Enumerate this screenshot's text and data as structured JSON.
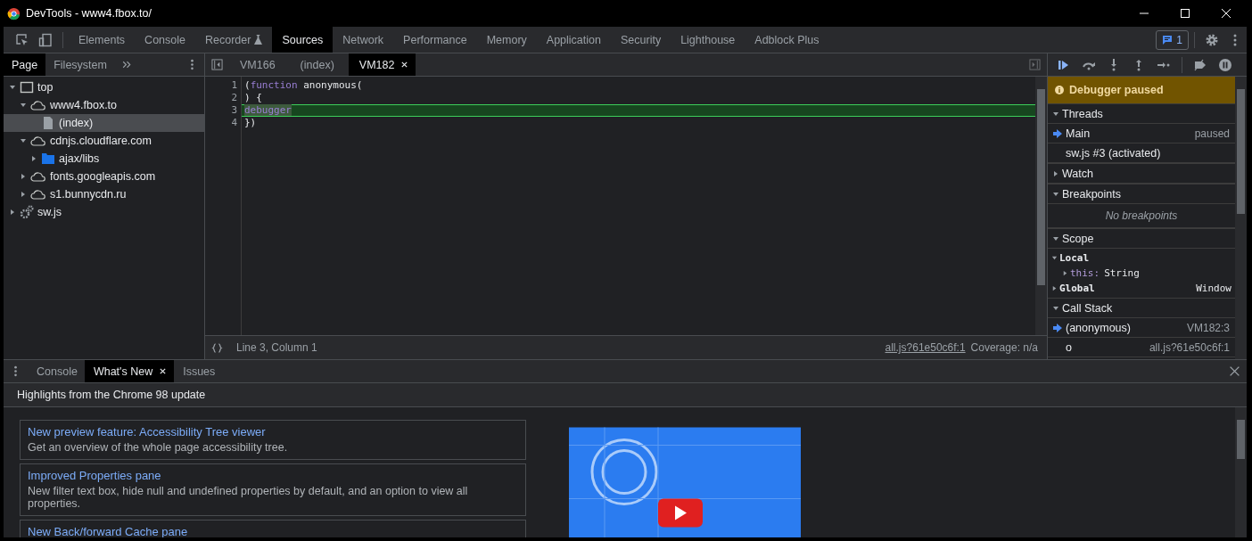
{
  "window": {
    "title": "DevTools - www4.fbox.to/"
  },
  "main_tabs": [
    {
      "label": "Elements",
      "selected": false,
      "experimental": false
    },
    {
      "label": "Console",
      "selected": false,
      "experimental": false
    },
    {
      "label": "Recorder",
      "selected": false,
      "experimental": true
    },
    {
      "label": "Sources",
      "selected": true,
      "experimental": false
    },
    {
      "label": "Network",
      "selected": false,
      "experimental": false
    },
    {
      "label": "Performance",
      "selected": false,
      "experimental": false
    },
    {
      "label": "Memory",
      "selected": false,
      "experimental": false
    },
    {
      "label": "Application",
      "selected": false,
      "experimental": false
    },
    {
      "label": "Security",
      "selected": false,
      "experimental": false
    },
    {
      "label": "Lighthouse",
      "selected": false,
      "experimental": false
    },
    {
      "label": "Adblock Plus",
      "selected": false,
      "experimental": false
    }
  ],
  "issues_button": {
    "count": "1"
  },
  "navigator": {
    "tabs": [
      {
        "label": "Page",
        "selected": true
      },
      {
        "label": "Filesystem",
        "selected": false
      }
    ],
    "tree": [
      {
        "label": "top",
        "kind": "frame",
        "expanded": true,
        "selected": false,
        "children": [
          {
            "label": "www4.fbox.to",
            "kind": "cloud",
            "expanded": true,
            "selected": false,
            "children": [
              {
                "label": "(index)",
                "kind": "file",
                "selected": true
              }
            ]
          },
          {
            "label": "cdnjs.cloudflare.com",
            "kind": "cloud",
            "expanded": true,
            "selected": false,
            "children": [
              {
                "label": "ajax/libs",
                "kind": "folder",
                "expanded": false,
                "selected": false
              }
            ]
          },
          {
            "label": "fonts.googleapis.com",
            "kind": "cloud",
            "expanded": false,
            "selected": false
          },
          {
            "label": "s1.bunnycdn.ru",
            "kind": "cloud",
            "expanded": false,
            "selected": false
          }
        ]
      },
      {
        "label": "sw.js",
        "kind": "gear",
        "expanded": false,
        "selected": false
      }
    ]
  },
  "editor": {
    "tabs": [
      {
        "label": "VM166",
        "selected": false
      },
      {
        "label": "(index)",
        "selected": false
      },
      {
        "label": "VM182",
        "selected": true
      }
    ],
    "lines": [
      {
        "number": "1",
        "highlighted": false,
        "tokens": [
          {
            "text": "(",
            "kind": "plain"
          },
          {
            "text": "function",
            "kind": "keyword"
          },
          {
            "text": " anonymous(",
            "kind": "plain"
          }
        ]
      },
      {
        "number": "2",
        "highlighted": false,
        "tokens": [
          {
            "text": ") {",
            "kind": "plain"
          }
        ]
      },
      {
        "number": "3",
        "highlighted": true,
        "tokens": [
          {
            "text": "debugger",
            "kind": "keyword"
          }
        ]
      },
      {
        "number": "4",
        "highlighted": false,
        "tokens": [
          {
            "text": "})",
            "kind": "plain"
          }
        ]
      }
    ],
    "position": "Line 3, Column 1",
    "source_link": "all.js?61e50c6f:1",
    "coverage": "Coverage: n/a"
  },
  "debugger": {
    "banner": "Debugger paused",
    "threads": {
      "label": "Threads",
      "expanded": true,
      "items": [
        {
          "name": "Main",
          "status": "paused",
          "current": true
        },
        {
          "name": "sw.js #3 (activated)",
          "current": false
        }
      ]
    },
    "watch": {
      "label": "Watch",
      "expanded": false
    },
    "breakpoints": {
      "label": "Breakpoints",
      "expanded": true,
      "empty_text": "No breakpoints"
    },
    "scope": {
      "label": "Scope",
      "expanded": true,
      "items": [
        {
          "name": "Local",
          "expanded": true,
          "children": [
            {
              "name": "this:",
              "value": "String",
              "expanded": false
            }
          ]
        },
        {
          "name": "Global",
          "value": "Window",
          "expanded": false
        }
      ]
    },
    "call_stack": {
      "label": "Call Stack",
      "expanded": true,
      "frames": [
        {
          "name": "(anonymous)",
          "location": "VM182:3",
          "current": true
        },
        {
          "name": "o",
          "location": "all.js?61e50c6f:1",
          "current": false
        }
      ]
    }
  },
  "drawer": {
    "tabs": [
      {
        "label": "Console",
        "selected": false
      },
      {
        "label": "What's New",
        "selected": true
      },
      {
        "label": "Issues",
        "selected": false
      }
    ],
    "heading": "Highlights from the Chrome 98 update",
    "cards": [
      {
        "title": "New preview feature: Accessibility Tree viewer",
        "description": "Get an overview of the whole page accessibility tree."
      },
      {
        "title": "Improved Properties pane",
        "description": "New filter text box, hide null and undefined properties by default, and an option to view all properties."
      },
      {
        "title": "New Back/forward Cache pane"
      }
    ]
  }
}
